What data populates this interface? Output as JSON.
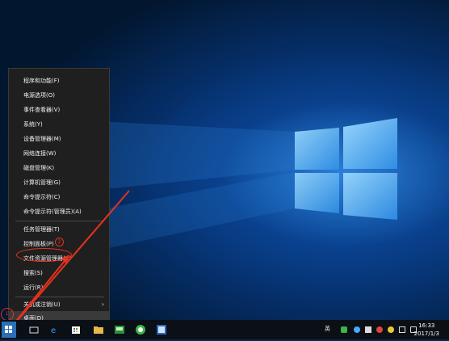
{
  "context_menu": {
    "items": [
      {
        "label": "程序和功能(F)"
      },
      {
        "label": "电源选项(O)"
      },
      {
        "label": "事件查看器(V)"
      },
      {
        "label": "系统(Y)"
      },
      {
        "label": "设备管理器(M)"
      },
      {
        "label": "网络连接(W)"
      },
      {
        "label": "磁盘管理(K)"
      },
      {
        "label": "计算机管理(G)"
      },
      {
        "label": "命令提示符(C)"
      },
      {
        "label": "命令提示符(管理员)(A)"
      },
      {
        "label": "任务管理器(T)"
      },
      {
        "label": "控制面板(P)"
      },
      {
        "label": "文件资源管理器(E)"
      },
      {
        "label": "搜索(S)"
      },
      {
        "label": "运行(R)"
      },
      {
        "label": "关机或注销(U)"
      },
      {
        "label": "桌面(D)"
      }
    ],
    "submenu_arrow": "›"
  },
  "annotations": {
    "step1": "1",
    "step2": "2"
  },
  "tray": {
    "ime": "英",
    "time": "16:33",
    "date": "2017/1/3"
  },
  "colors": {
    "annotation": "#e8321e",
    "menu_bg": "#1f1f1f",
    "taskbar_bg": "#0b0f16"
  }
}
